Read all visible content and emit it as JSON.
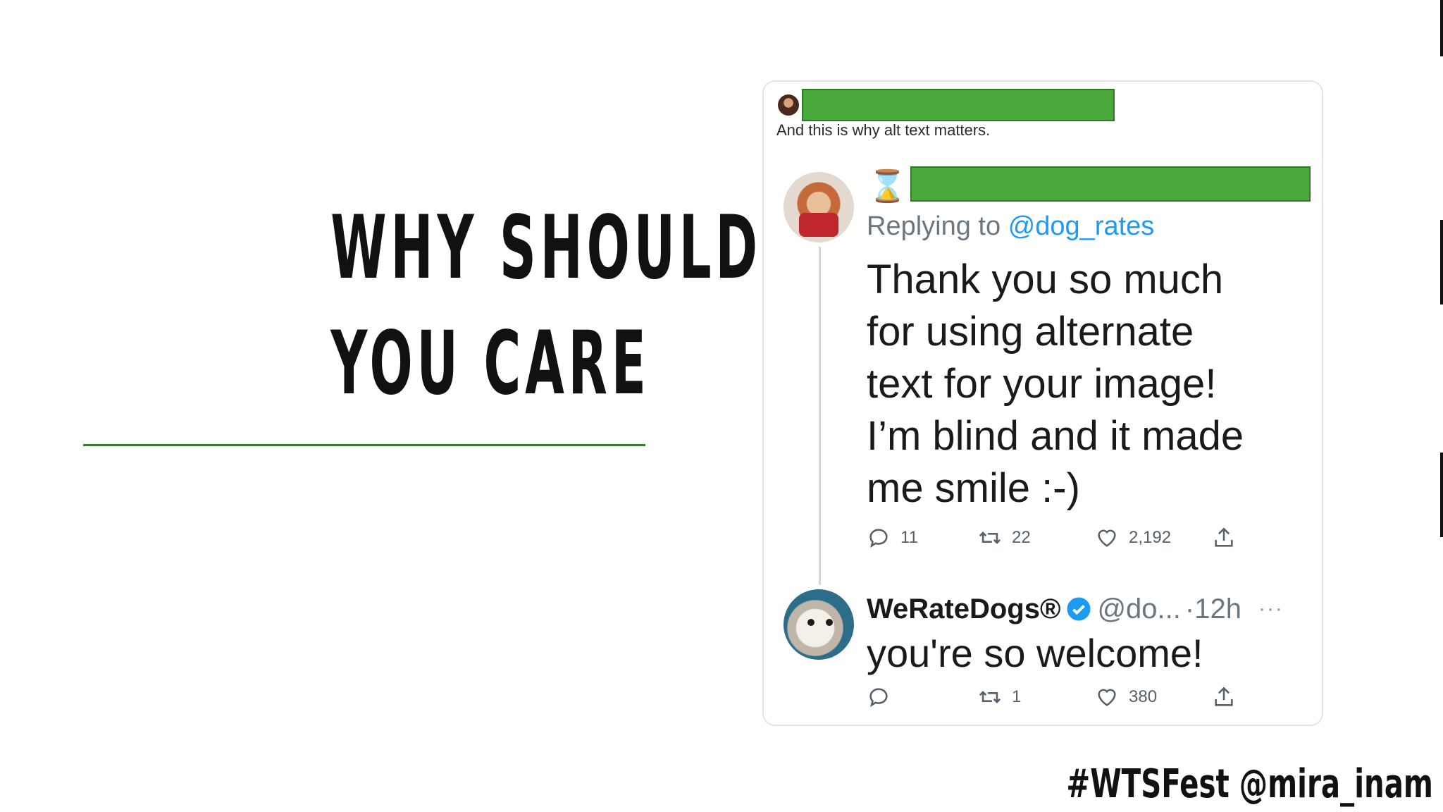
{
  "slide": {
    "title_line1": "WHY SHOULD",
    "title_line2": "YOU CARE",
    "footer": "#WTSFest @mira_inam",
    "accent_color": "#3b7a2e"
  },
  "card": {
    "quote_text": "And this is why alt text matters.",
    "redaction_color": "#4caa3c",
    "tweet": {
      "status_icon": "hourglass-icon",
      "replying_prefix": "Replying to",
      "replying_handle": "@dog_rates",
      "body_lines": [
        "Thank you so much",
        "for using alternate",
        "text for your image!",
        "I’m blind and it made",
        "me smile :-)"
      ],
      "replies": "11",
      "retweets": "22",
      "likes": "2,192"
    },
    "reply": {
      "name": "WeRateDogs®",
      "handle": "@do...",
      "time": "·12h",
      "more": "···",
      "body": "you're so welcome!",
      "replies": "",
      "retweets": "1",
      "likes": "380"
    }
  }
}
